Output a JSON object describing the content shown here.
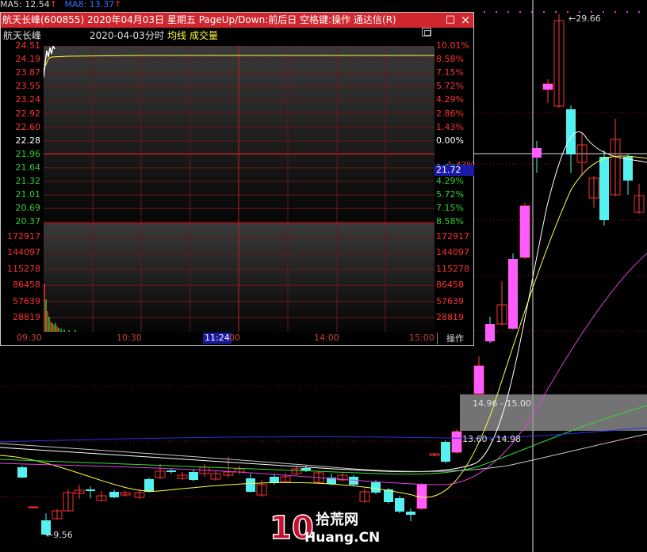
{
  "legend": {
    "ma5": "MA5: 12.54",
    "ma5_arrow": "↑",
    "ma8": "MA8: 13.37",
    "ma8_arrow": "↑"
  },
  "main_chart": {
    "high_label": "29.66",
    "low_label": "9.56",
    "zone_upper_label": "14.96 - 15.00",
    "zone_lower_label": "13.60 - 14.98",
    "colors": {
      "up": "#ff5cff",
      "down": "#55f0f0",
      "ma_white": "#ffffff",
      "ma_yellow": "#ffff40",
      "ma_magenta": "#e040e0",
      "ma_green": "#30e030",
      "ma_blue": "#3030e0"
    }
  },
  "popup": {
    "title": "航天长峰(600855)  2020年04月03日  星期五  PageUp/Down:前后日  空格键:操作  通达信(R)",
    "minimize_icon": "□",
    "close_icon": "×",
    "stock_name": "航天长峰",
    "date": "2020-04-03",
    "mode": "分时",
    "avg_line_label": "均线",
    "volume_label": "成交量",
    "price_levels": [
      "24.51",
      "24.19",
      "23.87",
      "23.55",
      "23.24",
      "22.92",
      "22.60",
      "22.28",
      "21.96",
      "21.64",
      "21.32",
      "21.01",
      "20.69",
      "20.37"
    ],
    "percent_levels": [
      "10.01%",
      "8.58%",
      "7.15%",
      "5.72%",
      "4.29%",
      "2.86%",
      "1.43%",
      "0.00%",
      "2.86%",
      "4.29%",
      "5.72%",
      "7.15%",
      "8.58%"
    ],
    "volume_levels": [
      "172917",
      "144097",
      "115278",
      "86458",
      "57639",
      "28819"
    ],
    "time_labels": [
      "09:30",
      "10:30",
      "11:24",
      "00",
      "14:00",
      "15:00"
    ],
    "cursor_price": "21.72",
    "operate_button": "操作",
    "colors": {
      "up": "#ff3030",
      "down": "#30d030",
      "flat": "#ffffff"
    }
  },
  "watermark": {
    "number": "10",
    "cn_text": "拾荒网",
    "domain": "Huang.CN"
  }
}
